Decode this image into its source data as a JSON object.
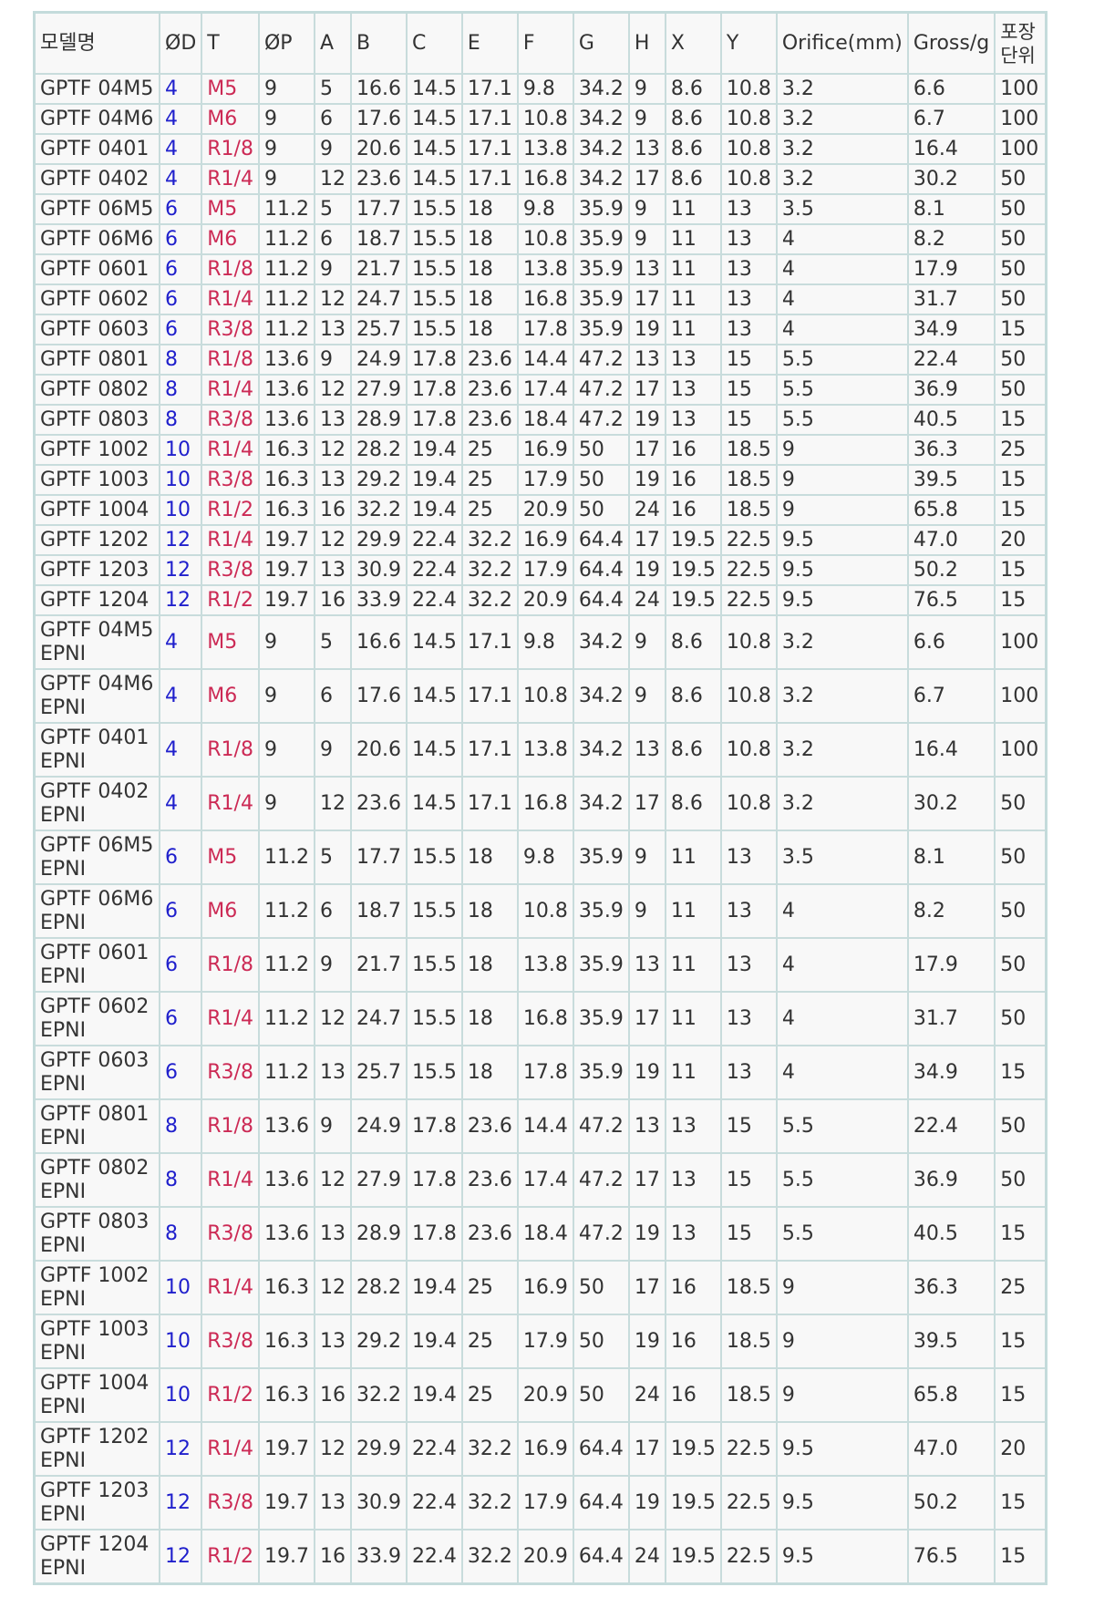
{
  "colors": {
    "od": "#1f1fcc",
    "thread": "#cc2a55",
    "text": "#333333",
    "border": "#c8dcdc"
  },
  "headers": [
    "모델명",
    "ØD",
    "T",
    "ØP",
    "A",
    "B",
    "C",
    "E",
    "F",
    "G",
    "H",
    "X",
    "Y",
    "Orifice(mm)",
    "Gross/g",
    "포장 단위"
  ],
  "rows": [
    [
      "GPTF 04M5",
      "4",
      "M5",
      "9",
      "5",
      "16.6",
      "14.5",
      "17.1",
      "9.8",
      "34.2",
      "9",
      "8.6",
      "10.8",
      "3.2",
      "6.6",
      "100"
    ],
    [
      "GPTF 04M6",
      "4",
      "M6",
      "9",
      "6",
      "17.6",
      "14.5",
      "17.1",
      "10.8",
      "34.2",
      "9",
      "8.6",
      "10.8",
      "3.2",
      "6.7",
      "100"
    ],
    [
      "GPTF 0401",
      "4",
      "R1/8",
      "9",
      "9",
      "20.6",
      "14.5",
      "17.1",
      "13.8",
      "34.2",
      "13",
      "8.6",
      "10.8",
      "3.2",
      "16.4",
      "100"
    ],
    [
      "GPTF 0402",
      "4",
      "R1/4",
      "9",
      "12",
      "23.6",
      "14.5",
      "17.1",
      "16.8",
      "34.2",
      "17",
      "8.6",
      "10.8",
      "3.2",
      "30.2",
      "50"
    ],
    [
      "GPTF 06M5",
      "6",
      "M5",
      "11.2",
      "5",
      "17.7",
      "15.5",
      "18",
      "9.8",
      "35.9",
      "9",
      "11",
      "13",
      "3.5",
      "8.1",
      "50"
    ],
    [
      "GPTF 06M6",
      "6",
      "M6",
      "11.2",
      "6",
      "18.7",
      "15.5",
      "18",
      "10.8",
      "35.9",
      "9",
      "11",
      "13",
      "4",
      "8.2",
      "50"
    ],
    [
      "GPTF 0601",
      "6",
      "R1/8",
      "11.2",
      "9",
      "21.7",
      "15.5",
      "18",
      "13.8",
      "35.9",
      "13",
      "11",
      "13",
      "4",
      "17.9",
      "50"
    ],
    [
      "GPTF 0602",
      "6",
      "R1/4",
      "11.2",
      "12",
      "24.7",
      "15.5",
      "18",
      "16.8",
      "35.9",
      "17",
      "11",
      "13",
      "4",
      "31.7",
      "50"
    ],
    [
      "GPTF 0603",
      "6",
      "R3/8",
      "11.2",
      "13",
      "25.7",
      "15.5",
      "18",
      "17.8",
      "35.9",
      "19",
      "11",
      "13",
      "4",
      "34.9",
      "15"
    ],
    [
      "GPTF 0801",
      "8",
      "R1/8",
      "13.6",
      "9",
      "24.9",
      "17.8",
      "23.6",
      "14.4",
      "47.2",
      "13",
      "13",
      "15",
      "5.5",
      "22.4",
      "50"
    ],
    [
      "GPTF 0802",
      "8",
      "R1/4",
      "13.6",
      "12",
      "27.9",
      "17.8",
      "23.6",
      "17.4",
      "47.2",
      "17",
      "13",
      "15",
      "5.5",
      "36.9",
      "50"
    ],
    [
      "GPTF 0803",
      "8",
      "R3/8",
      "13.6",
      "13",
      "28.9",
      "17.8",
      "23.6",
      "18.4",
      "47.2",
      "19",
      "13",
      "15",
      "5.5",
      "40.5",
      "15"
    ],
    [
      "GPTF 1002",
      "10",
      "R1/4",
      "16.3",
      "12",
      "28.2",
      "19.4",
      "25",
      "16.9",
      "50",
      "17",
      "16",
      "18.5",
      "9",
      "36.3",
      "25"
    ],
    [
      "GPTF 1003",
      "10",
      "R3/8",
      "16.3",
      "13",
      "29.2",
      "19.4",
      "25",
      "17.9",
      "50",
      "19",
      "16",
      "18.5",
      "9",
      "39.5",
      "15"
    ],
    [
      "GPTF 1004",
      "10",
      "R1/2",
      "16.3",
      "16",
      "32.2",
      "19.4",
      "25",
      "20.9",
      "50",
      "24",
      "16",
      "18.5",
      "9",
      "65.8",
      "15"
    ],
    [
      "GPTF 1202",
      "12",
      "R1/4",
      "19.7",
      "12",
      "29.9",
      "22.4",
      "32.2",
      "16.9",
      "64.4",
      "17",
      "19.5",
      "22.5",
      "9.5",
      "47.0",
      "20"
    ],
    [
      "GPTF 1203",
      "12",
      "R3/8",
      "19.7",
      "13",
      "30.9",
      "22.4",
      "32.2",
      "17.9",
      "64.4",
      "19",
      "19.5",
      "22.5",
      "9.5",
      "50.2",
      "15"
    ],
    [
      "GPTF 1204",
      "12",
      "R1/2",
      "19.7",
      "16",
      "33.9",
      "22.4",
      "32.2",
      "20.9",
      "64.4",
      "24",
      "19.5",
      "22.5",
      "9.5",
      "76.5",
      "15"
    ],
    [
      "GPTF 04M5 EPNI",
      "4",
      "M5",
      "9",
      "5",
      "16.6",
      "14.5",
      "17.1",
      "9.8",
      "34.2",
      "9",
      "8.6",
      "10.8",
      "3.2",
      "6.6",
      "100"
    ],
    [
      "GPTF 04M6 EPNI",
      "4",
      "M6",
      "9",
      "6",
      "17.6",
      "14.5",
      "17.1",
      "10.8",
      "34.2",
      "9",
      "8.6",
      "10.8",
      "3.2",
      "6.7",
      "100"
    ],
    [
      "GPTF 0401 EPNI",
      "4",
      "R1/8",
      "9",
      "9",
      "20.6",
      "14.5",
      "17.1",
      "13.8",
      "34.2",
      "13",
      "8.6",
      "10.8",
      "3.2",
      "16.4",
      "100"
    ],
    [
      "GPTF 0402 EPNI",
      "4",
      "R1/4",
      "9",
      "12",
      "23.6",
      "14.5",
      "17.1",
      "16.8",
      "34.2",
      "17",
      "8.6",
      "10.8",
      "3.2",
      "30.2",
      "50"
    ],
    [
      "GPTF 06M5 EPNI",
      "6",
      "M5",
      "11.2",
      "5",
      "17.7",
      "15.5",
      "18",
      "9.8",
      "35.9",
      "9",
      "11",
      "13",
      "3.5",
      "8.1",
      "50"
    ],
    [
      "GPTF 06M6 EPNI",
      "6",
      "M6",
      "11.2",
      "6",
      "18.7",
      "15.5",
      "18",
      "10.8",
      "35.9",
      "9",
      "11",
      "13",
      "4",
      "8.2",
      "50"
    ],
    [
      "GPTF 0601 EPNI",
      "6",
      "R1/8",
      "11.2",
      "9",
      "21.7",
      "15.5",
      "18",
      "13.8",
      "35.9",
      "13",
      "11",
      "13",
      "4",
      "17.9",
      "50"
    ],
    [
      "GPTF 0602 EPNI",
      "6",
      "R1/4",
      "11.2",
      "12",
      "24.7",
      "15.5",
      "18",
      "16.8",
      "35.9",
      "17",
      "11",
      "13",
      "4",
      "31.7",
      "50"
    ],
    [
      "GPTF 0603 EPNI",
      "6",
      "R3/8",
      "11.2",
      "13",
      "25.7",
      "15.5",
      "18",
      "17.8",
      "35.9",
      "19",
      "11",
      "13",
      "4",
      "34.9",
      "15"
    ],
    [
      "GPTF 0801 EPNI",
      "8",
      "R1/8",
      "13.6",
      "9",
      "24.9",
      "17.8",
      "23.6",
      "14.4",
      "47.2",
      "13",
      "13",
      "15",
      "5.5",
      "22.4",
      "50"
    ],
    [
      "GPTF 0802 EPNI",
      "8",
      "R1/4",
      "13.6",
      "12",
      "27.9",
      "17.8",
      "23.6",
      "17.4",
      "47.2",
      "17",
      "13",
      "15",
      "5.5",
      "36.9",
      "50"
    ],
    [
      "GPTF 0803 EPNI",
      "8",
      "R3/8",
      "13.6",
      "13",
      "28.9",
      "17.8",
      "23.6",
      "18.4",
      "47.2",
      "19",
      "13",
      "15",
      "5.5",
      "40.5",
      "15"
    ],
    [
      "GPTF 1002 EPNI",
      "10",
      "R1/4",
      "16.3",
      "12",
      "28.2",
      "19.4",
      "25",
      "16.9",
      "50",
      "17",
      "16",
      "18.5",
      "9",
      "36.3",
      "25"
    ],
    [
      "GPTF 1003 EPNI",
      "10",
      "R3/8",
      "16.3",
      "13",
      "29.2",
      "19.4",
      "25",
      "17.9",
      "50",
      "19",
      "16",
      "18.5",
      "9",
      "39.5",
      "15"
    ],
    [
      "GPTF 1004 EPNI",
      "10",
      "R1/2",
      "16.3",
      "16",
      "32.2",
      "19.4",
      "25",
      "20.9",
      "50",
      "24",
      "16",
      "18.5",
      "9",
      "65.8",
      "15"
    ],
    [
      "GPTF 1202 EPNI",
      "12",
      "R1/4",
      "19.7",
      "12",
      "29.9",
      "22.4",
      "32.2",
      "16.9",
      "64.4",
      "17",
      "19.5",
      "22.5",
      "9.5",
      "47.0",
      "20"
    ],
    [
      "GPTF 1203 EPNI",
      "12",
      "R3/8",
      "19.7",
      "13",
      "30.9",
      "22.4",
      "32.2",
      "17.9",
      "64.4",
      "19",
      "19.5",
      "22.5",
      "9.5",
      "50.2",
      "15"
    ],
    [
      "GPTF 1204 EPNI",
      "12",
      "R1/2",
      "19.7",
      "16",
      "33.9",
      "22.4",
      "32.2",
      "20.9",
      "64.4",
      "24",
      "19.5",
      "22.5",
      "9.5",
      "76.5",
      "15"
    ]
  ]
}
